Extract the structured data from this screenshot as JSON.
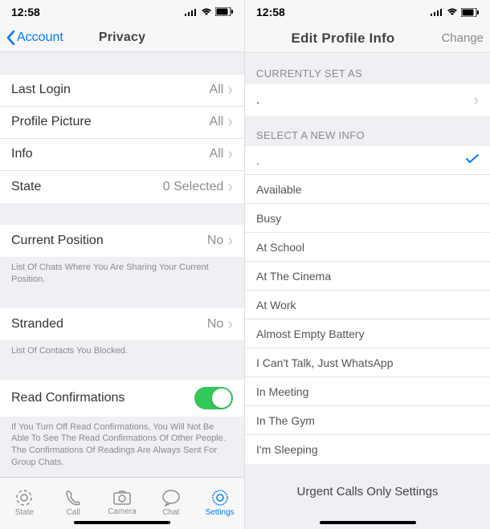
{
  "status": {
    "time": "12:58"
  },
  "left": {
    "nav": {
      "back": "Account",
      "title": "Privacy"
    },
    "rows": {
      "lastLogin": {
        "label": "Last Login",
        "value": "All"
      },
      "profilePic": {
        "label": "Profile Picture",
        "value": "All"
      },
      "info": {
        "label": "Info",
        "value": "All"
      },
      "state": {
        "label": "State",
        "value": "0 Selected"
      },
      "position": {
        "label": "Current Position",
        "value": "No"
      },
      "stranded": {
        "label": "Stranded",
        "value": "No"
      },
      "readConf": {
        "label": "Read Confirmations"
      }
    },
    "notes": {
      "position": "List Of Chats Where You Are Sharing Your Current Position.",
      "stranded": "List Of Contacts You Blocked.",
      "readConf": "If You Turn Off Read Confirmations, You Will Not Be Able To See The Read Confirmations Of Other People. The Confirmations Of Readings Are Always Sent For Group Chats."
    },
    "tabs": {
      "state": "State",
      "call": "Call",
      "camera": "Camera",
      "chat": "Chat",
      "settings": "Settings"
    }
  },
  "right": {
    "nav": {
      "title": "Edit Profile Info",
      "change": "Change"
    },
    "headers": {
      "current": "CURRENTLY SET AS",
      "select": "SELECT A NEW INFO"
    },
    "currentValue": ".",
    "options": [
      ".",
      "Available",
      "Busy",
      "At School",
      "At The Cinema",
      "At Work",
      "Almost Empty Battery",
      "I Can't Talk, Just WhatsApp",
      "In Meeting",
      "In The Gym",
      "I'm Sleeping"
    ],
    "bottom": "Urgent Calls Only Settings"
  }
}
